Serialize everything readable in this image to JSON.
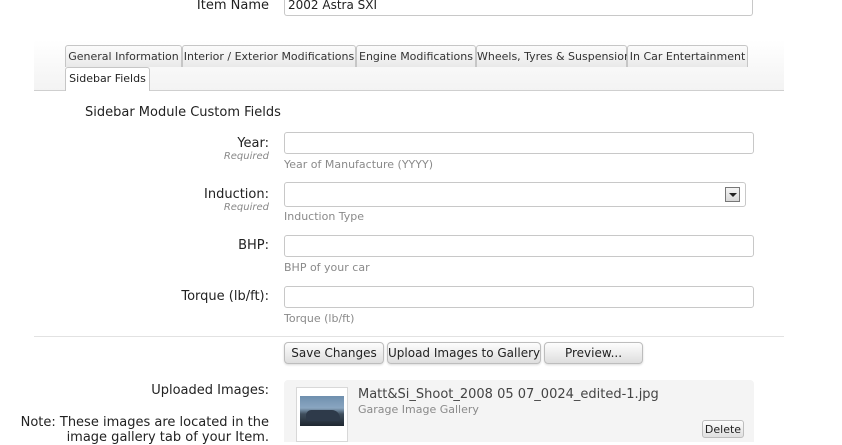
{
  "item_name": {
    "label": "Item Name",
    "value": "2002 Astra SXI"
  },
  "tabs": [
    {
      "label": "General Information"
    },
    {
      "label": "Interior / Exterior Modifications"
    },
    {
      "label": "Engine Modifications"
    },
    {
      "label": "Wheels, Tyres & Suspension"
    },
    {
      "label": "In Car Entertainment"
    },
    {
      "label": "Sidebar Fields"
    }
  ],
  "section_title": "Sidebar Module Custom Fields",
  "fields": {
    "year": {
      "label": "Year:",
      "required": "Required",
      "value": "",
      "hint": "Year of Manufacture (YYYY)"
    },
    "induction": {
      "label": "Induction:",
      "required": "Required",
      "selected": "",
      "hint": "Induction Type"
    },
    "bhp": {
      "label": "BHP:",
      "value": "",
      "hint": "BHP of your car"
    },
    "torque": {
      "label": "Torque (lb/ft):",
      "value": "",
      "hint": "Torque (lb/ft)"
    }
  },
  "buttons": {
    "save": "Save Changes",
    "upload": "Upload Images to Gallery",
    "preview": "Preview..."
  },
  "uploaded": {
    "label": "Uploaded Images:",
    "note_line1": "Note: These images are located in the",
    "note_line2": "image gallery tab of your Item.",
    "image": {
      "filename": "Matt&Si_Shoot_2008 05 07_0024_edited-1.jpg",
      "gallery": "Garage Image Gallery",
      "delete_label": "Delete"
    }
  }
}
